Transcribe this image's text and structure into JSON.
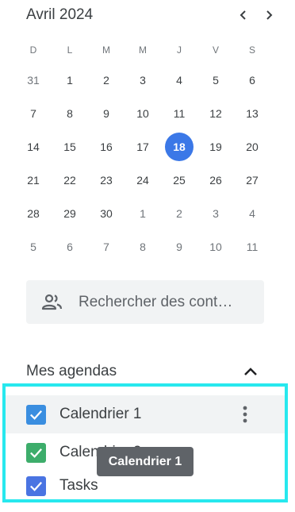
{
  "mini_calendar": {
    "title": "Avril 2024",
    "prev_label": "mois précédent",
    "next_label": "mois suivant",
    "weekdays": [
      "D",
      "L",
      "M",
      "M",
      "J",
      "V",
      "S"
    ],
    "weeks": [
      [
        {
          "d": "31",
          "muted": true
        },
        {
          "d": "1"
        },
        {
          "d": "2"
        },
        {
          "d": "3"
        },
        {
          "d": "4"
        },
        {
          "d": "5"
        },
        {
          "d": "6"
        }
      ],
      [
        {
          "d": "7"
        },
        {
          "d": "8"
        },
        {
          "d": "9"
        },
        {
          "d": "10"
        },
        {
          "d": "11"
        },
        {
          "d": "12"
        },
        {
          "d": "13"
        }
      ],
      [
        {
          "d": "14"
        },
        {
          "d": "15"
        },
        {
          "d": "16"
        },
        {
          "d": "17"
        },
        {
          "d": "18",
          "today": true
        },
        {
          "d": "19"
        },
        {
          "d": "20"
        }
      ],
      [
        {
          "d": "21"
        },
        {
          "d": "22"
        },
        {
          "d": "23"
        },
        {
          "d": "24"
        },
        {
          "d": "25"
        },
        {
          "d": "26"
        },
        {
          "d": "27"
        }
      ],
      [
        {
          "d": "28"
        },
        {
          "d": "29"
        },
        {
          "d": "30"
        },
        {
          "d": "1",
          "muted": true
        },
        {
          "d": "2",
          "muted": true
        },
        {
          "d": "3",
          "muted": true
        },
        {
          "d": "4",
          "muted": true
        }
      ],
      [
        {
          "d": "5",
          "muted": true
        },
        {
          "d": "6",
          "muted": true
        },
        {
          "d": "7",
          "muted": true
        },
        {
          "d": "8",
          "muted": true
        },
        {
          "d": "9",
          "muted": true
        },
        {
          "d": "10",
          "muted": true
        },
        {
          "d": "11",
          "muted": true
        }
      ]
    ]
  },
  "people_search": {
    "placeholder": "Rechercher des cont…",
    "icon": "people-icon"
  },
  "my_calendars": {
    "title": "Mes agendas",
    "items": [
      {
        "label": "Calendrier 1",
        "color": "#3a8ee0"
      },
      {
        "label": "Calendrier 2",
        "color": "#3dad6b"
      },
      {
        "label": "Tasks",
        "color": "#4a74e2"
      }
    ]
  },
  "tooltip": {
    "text": "Calendrier 1"
  },
  "colors": {
    "today": "#3b78e7",
    "highlight_border": "#27e8ee"
  }
}
